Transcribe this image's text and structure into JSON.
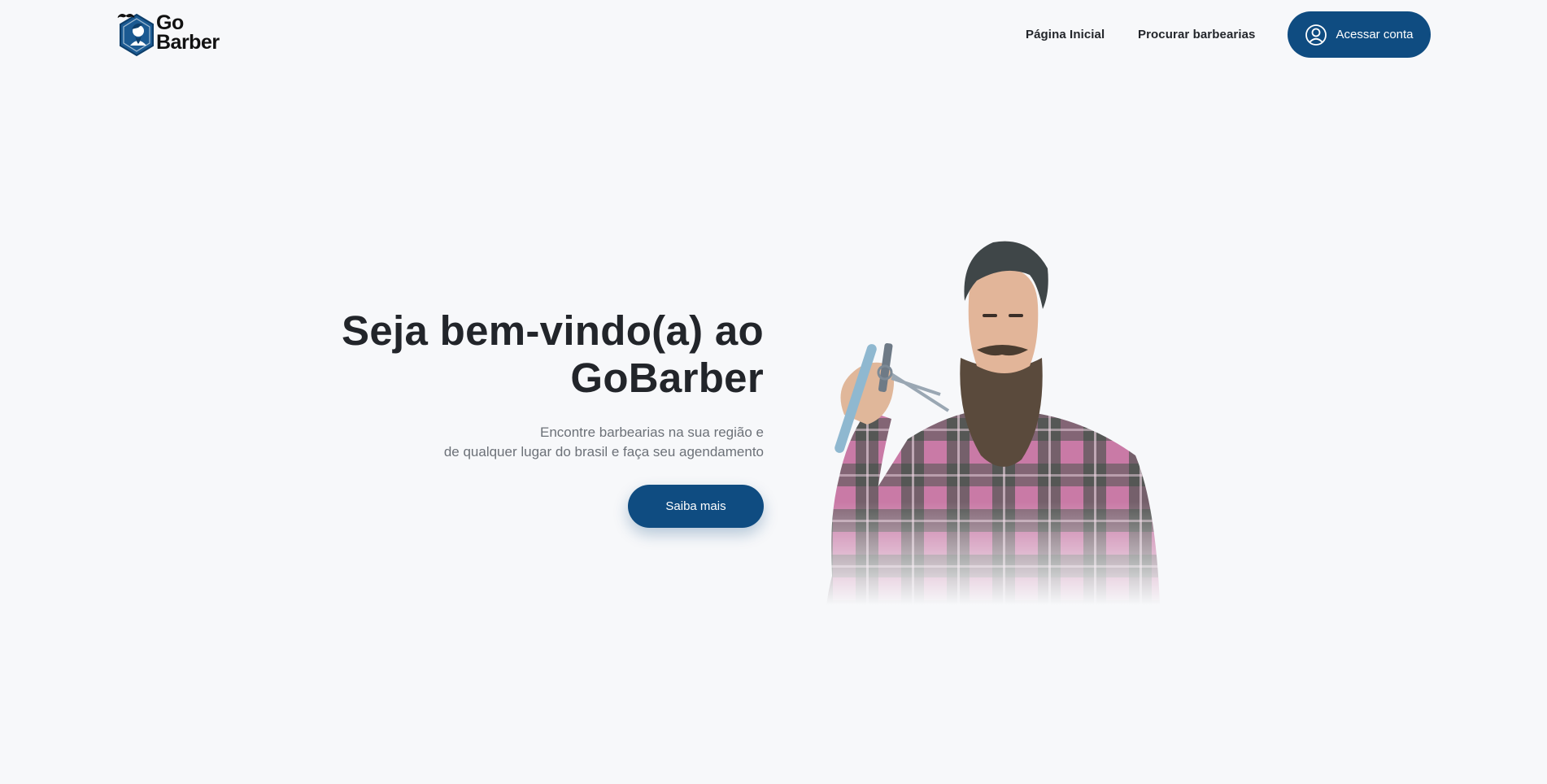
{
  "header": {
    "logo": {
      "line1": "Go",
      "line2": "Barber"
    },
    "nav": [
      {
        "label": "Página Inicial"
      },
      {
        "label": "Procurar barbearias"
      }
    ],
    "account_button": {
      "label": "Acessar conta",
      "icon": "user-circle-icon"
    }
  },
  "hero": {
    "title_line1": "Seja bem-vindo(a) ao",
    "title_line2": "GoBarber",
    "subtitle_line1": "Encontre barbearias na sua região e",
    "subtitle_line2": "de qualquer lugar do brasil e faça seu agendamento",
    "cta_label": "Saiba mais"
  },
  "colors": {
    "primary": "#0f4c81",
    "background": "#f7f8fa",
    "text": "#22252a",
    "muted": "#6c7178"
  }
}
